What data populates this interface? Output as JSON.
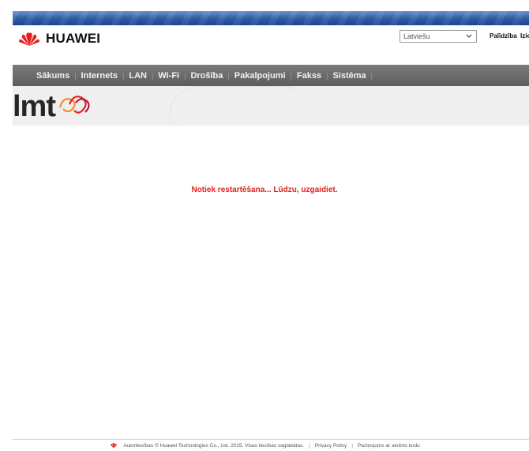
{
  "header": {
    "brand_name": "HUAWEI",
    "language_selected": "Latviešu",
    "help_label": "Palīdzība",
    "logout_label": "Iziet"
  },
  "nav": {
    "items": [
      {
        "label": "Sākums"
      },
      {
        "label": "Internets"
      },
      {
        "label": "LAN"
      },
      {
        "label": "Wi-Fi"
      },
      {
        "label": "Drošība"
      },
      {
        "label": "Pakalpojumi"
      },
      {
        "label": "Fakss"
      },
      {
        "label": "Sistēma"
      }
    ]
  },
  "operator": {
    "logo_text": "lmt"
  },
  "main": {
    "status_message": "Notiek restartēšana... Lūdzu, uzgaidiet."
  },
  "footer": {
    "copyright": "Autortiesības © Huawei Technologies Co., Ltd. 2015. Visas tiesības saglabātas.",
    "privacy_link": "Privacy Policy",
    "open_source_link": "Paziņojums ar atvērto kodu"
  },
  "colors": {
    "accent_red": "#e3211c",
    "nav_bg": "#666666",
    "top_blue": "#2b5aa3"
  }
}
